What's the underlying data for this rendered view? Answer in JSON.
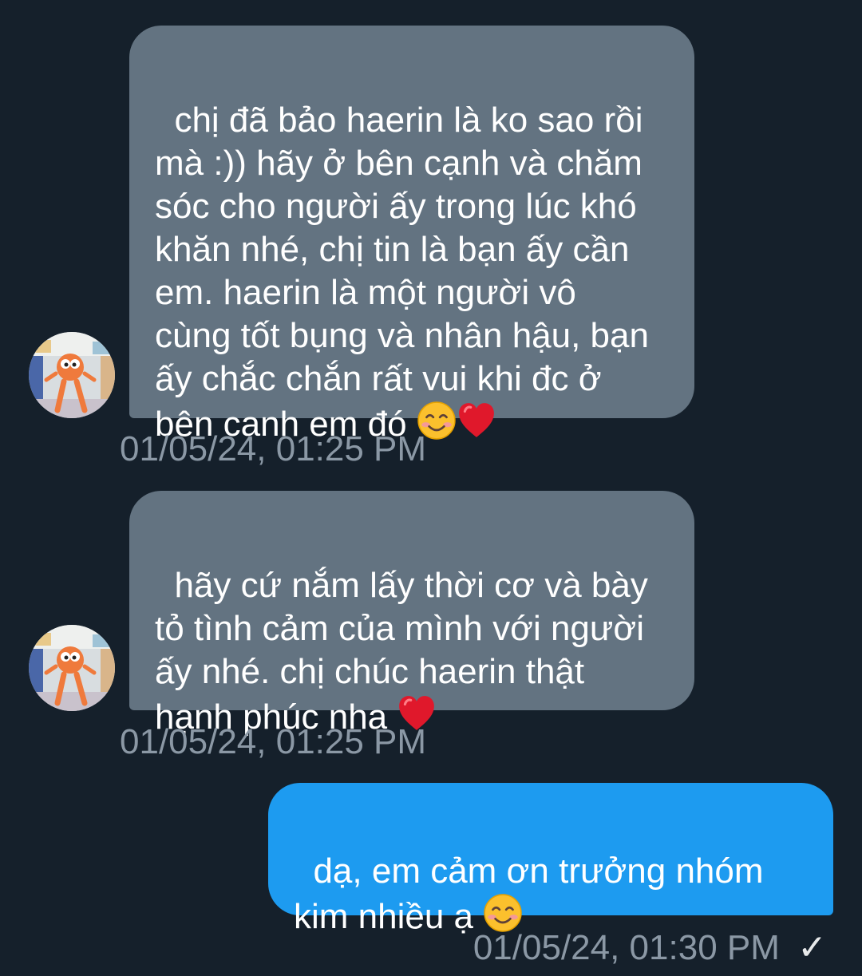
{
  "colors": {
    "background": "#15202b",
    "received_bubble": "#637381",
    "sent_bubble": "#1d9bf0",
    "timestamp_text": "#8b98a5"
  },
  "messages": [
    {
      "direction": "received",
      "text": "chị đã bảo haerin là ko sao rồi\nmà :)) hãy ở bên cạnh và chăm\nsóc cho người ấy trong lúc khó\nkhăn nhé, chị tin là bạn ấy cần\nem. haerin là một người vô\ncùng tốt bụng và nhân hậu, bạn\nấy chắc chắn rất vui khi đc ở\nbên cạnh em đó",
      "emoji": [
        "smiling-face-emoji",
        "red-heart-emoji"
      ],
      "timestamp": "01/05/24, 01:25 PM",
      "avatar": "cartoon-character-avatar"
    },
    {
      "direction": "received",
      "text": "hãy cứ nắm lấy thời cơ và bày\ntỏ tình cảm của mình với người\nấy nhé. chị chúc haerin thật\nhạnh phúc nha",
      "emoji": [
        "red-heart-emoji"
      ],
      "timestamp": "01/05/24, 01:25 PM",
      "avatar": "cartoon-character-avatar"
    },
    {
      "direction": "sent",
      "text": "dạ, em cảm ơn trưởng nhóm\nkim nhiều ạ",
      "emoji": [
        "smiling-face-emoji"
      ],
      "timestamp": "01/05/24, 01:30 PM",
      "status": "✓",
      "status_icon": "sent-check-icon"
    }
  ]
}
